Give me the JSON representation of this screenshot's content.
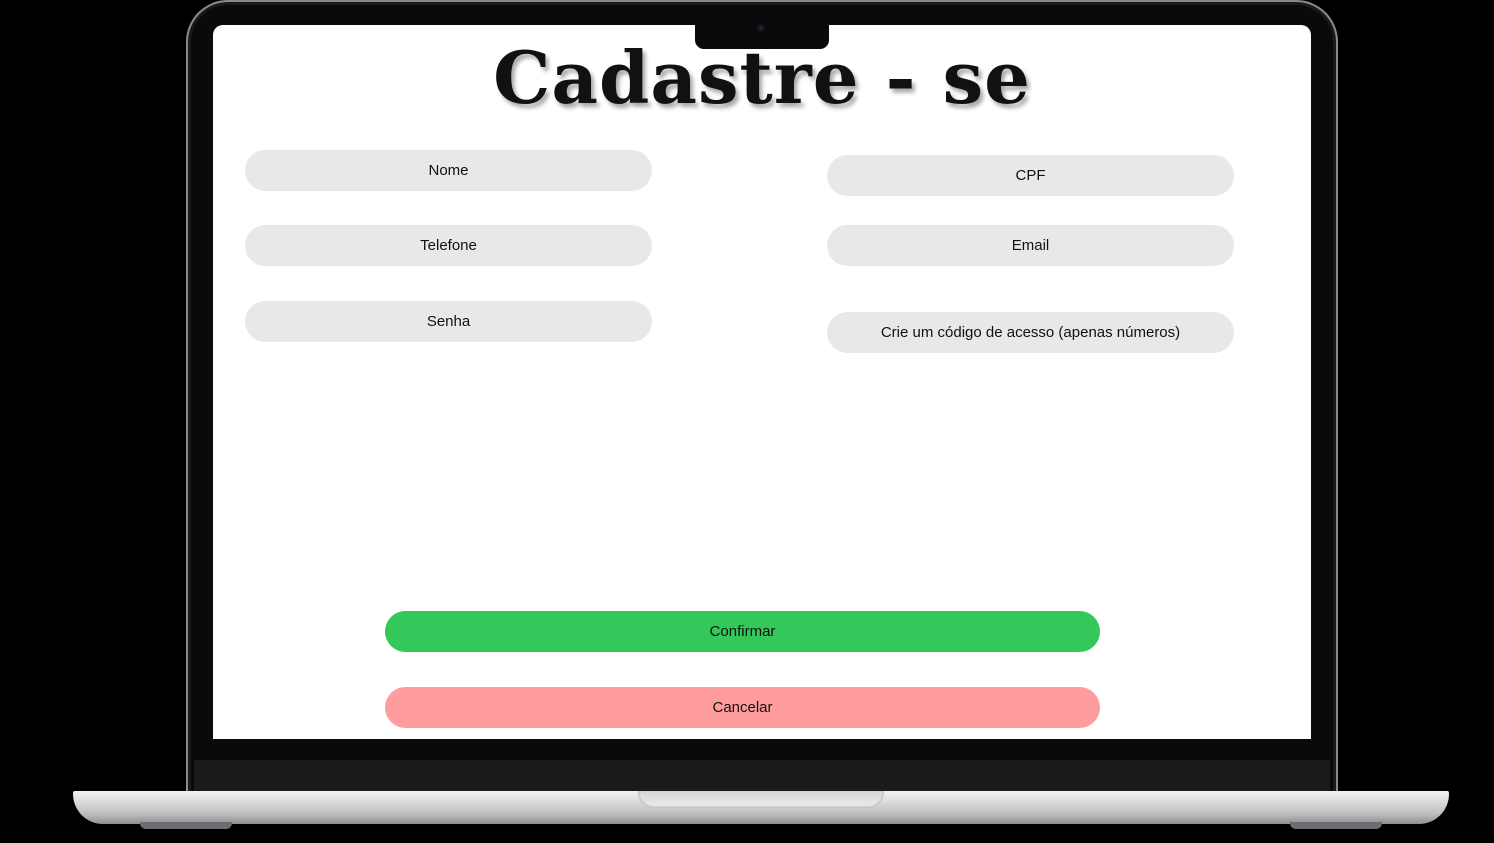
{
  "page": {
    "title": "Cadastre - se"
  },
  "form": {
    "nome_placeholder": "Nome",
    "cpf_placeholder": "CPF",
    "telefone_placeholder": "Telefone",
    "email_placeholder": "Email",
    "senha_placeholder": "Senha",
    "codigo_placeholder": "Crie um código de acesso (apenas números)"
  },
  "actions": {
    "confirm_label": "Confirmar",
    "cancel_label": "Cancelar"
  },
  "colors": {
    "field_background": "#e8e8e8",
    "confirm_background": "#34c85a",
    "cancel_background": "#ff9c9e",
    "device_frame": "#0a0a0a"
  }
}
